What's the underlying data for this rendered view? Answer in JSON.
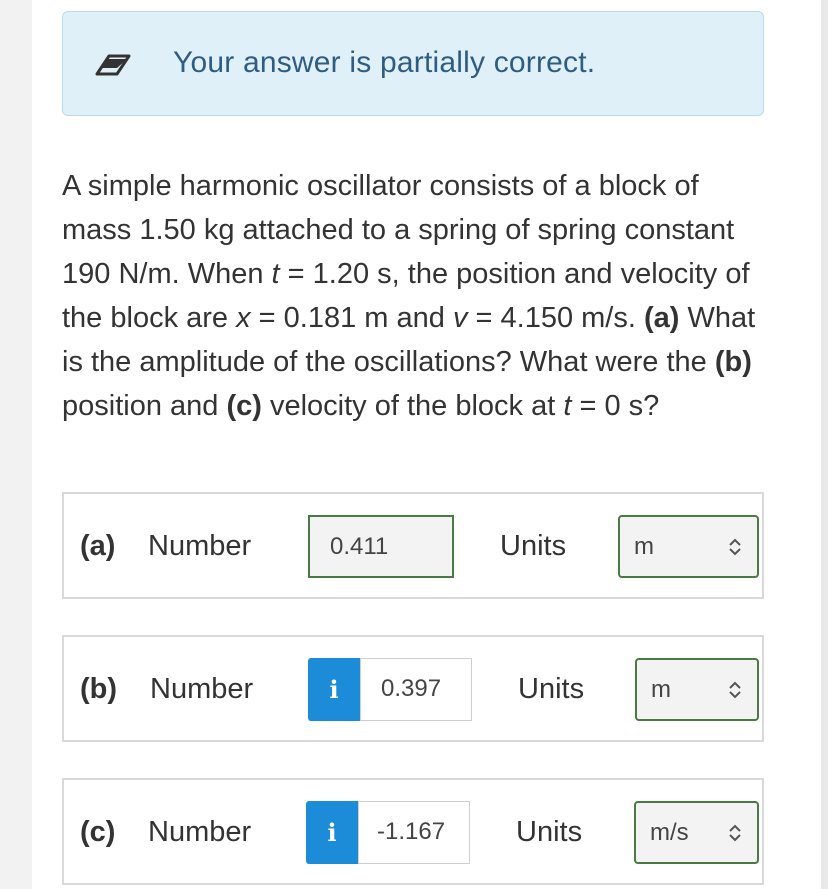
{
  "banner": {
    "message": "Your answer is partially correct."
  },
  "question": {
    "s1": "A simple harmonic oscillator consists of a block of mass 1.50 kg attached to a spring of spring constant 190 N/m. When ",
    "t_var": "t",
    "s2": " = 1.20 s, the position and velocity of the block are ",
    "x_var": "x",
    "s3": " = 0.181 m and ",
    "v_var": "v",
    "s4": " = 4.150 m/s. ",
    "a_label": "(a)",
    "s5": " What is the amplitude of the oscillations? What were the ",
    "b_label": "(b)",
    "s6": " position and ",
    "c_label": "(c)",
    "s7": " velocity of the block at ",
    "t_var2": "t",
    "s8": " = 0 s?"
  },
  "rows": [
    {
      "part": "(a)",
      "number_label": "Number",
      "value": "0.411",
      "units_label": "Units",
      "unit": "m"
    },
    {
      "part": "(b)",
      "number_label": "Number",
      "info": "i",
      "value": "0.397",
      "units_label": "Units",
      "unit": "m"
    },
    {
      "part": "(c)",
      "number_label": "Number",
      "info": "i",
      "value": "-1.167",
      "units_label": "Units",
      "unit": "m/s"
    }
  ],
  "colors": {
    "banner_bg": "#dff0f8",
    "banner_text": "#2f5d82",
    "correct_border": "#4a7a43",
    "info_blue": "#1c8cd9"
  },
  "icons": {
    "banner": "eraser-icon",
    "select": "chevron-up-down-icon",
    "info": "info-icon"
  }
}
